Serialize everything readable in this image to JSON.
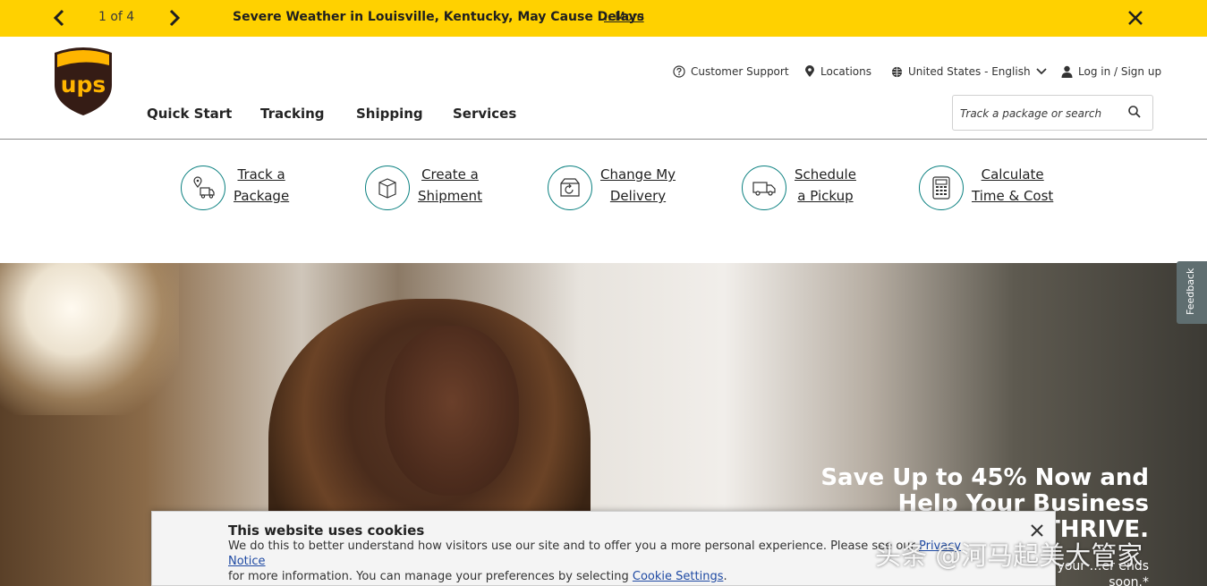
{
  "alert": {
    "count": "1 of 4",
    "message": "Severe Weather in Louisville, Kentucky, May Cause Delays",
    "more_link": "...More"
  },
  "brand": {
    "logo_text": "ups",
    "colors": {
      "brown": "#351c15",
      "gold": "#ffb500",
      "alert_yellow": "#ffd100",
      "teal": "#0a8080"
    }
  },
  "utility_nav": {
    "support": "Customer Support",
    "locations": "Locations",
    "language": "United States - English",
    "login": "Log in / Sign up"
  },
  "main_nav": [
    "Quick Start",
    "Tracking",
    "Shipping",
    "Services"
  ],
  "search": {
    "placeholder": "Track a package or search"
  },
  "quick_actions": [
    {
      "line1": "Track a",
      "line2": "Package",
      "icon": "package-tracking-icon"
    },
    {
      "line1": "Create a",
      "line2": "Shipment",
      "icon": "box-icon"
    },
    {
      "line1": "Change My",
      "line2": "Delivery",
      "icon": "delivery-change-icon"
    },
    {
      "line1": "Schedule",
      "line2": "a Pickup",
      "icon": "truck-icon"
    },
    {
      "line1": "Calculate",
      "line2": "Time & Cost",
      "icon": "calculator-icon"
    }
  ],
  "hero": {
    "headline": "Save Up to 45% Now and Help Your Business THRIVE.",
    "sub_text": "…on all of your …er ends soon.*"
  },
  "feedback": "Feedback",
  "cookie": {
    "title": "This website uses cookies",
    "text_1": "We do this to better understand how visitors use our site and to offer you a more personal experience. Please see our ",
    "privacy_link": "Privacy Notice",
    "text_2": "for more information. You can manage your preferences by selecting ",
    "settings_link": "Cookie Settings",
    "text_end": "."
  },
  "watermark": "头条 @河马起美大管家"
}
